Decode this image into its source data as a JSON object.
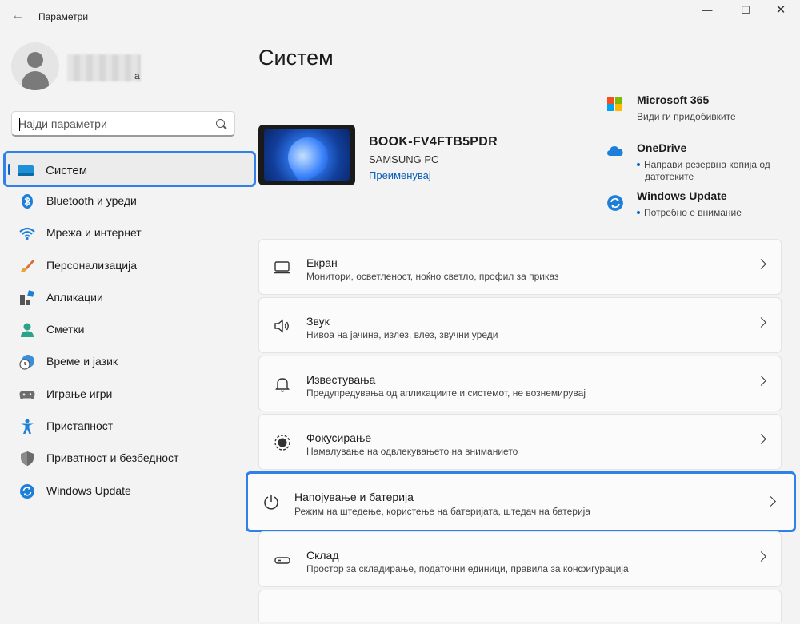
{
  "window": {
    "title": "Параметри",
    "back_label": "←",
    "minimize": "—",
    "maximize": "☐",
    "close": "✕"
  },
  "user": {
    "name_tail": "а"
  },
  "search": {
    "placeholder": "Најди параметри"
  },
  "sidebar": {
    "items": [
      {
        "label": "Систем",
        "icon": "system-icon",
        "active": true
      },
      {
        "label": "Bluetooth и уреди",
        "icon": "bluetooth-icon"
      },
      {
        "label": "Мрежа и интернет",
        "icon": "wifi-icon"
      },
      {
        "label": "Персонализација",
        "icon": "brush-icon"
      },
      {
        "label": "Апликации",
        "icon": "apps-icon"
      },
      {
        "label": "Сметки",
        "icon": "account-icon"
      },
      {
        "label": "Време и јазик",
        "icon": "clock-globe-icon"
      },
      {
        "label": "Играње игри",
        "icon": "gamepad-icon"
      },
      {
        "label": "Пристапност",
        "icon": "accessibility-icon"
      },
      {
        "label": "Приватност и безбедност",
        "icon": "shield-icon"
      },
      {
        "label": "Windows Update",
        "icon": "windows-update-icon"
      }
    ]
  },
  "main": {
    "title": "Систем",
    "device": {
      "name": "BOOK-FV4FTB5PDR",
      "model": "SAMSUNG PC",
      "rename": "Преименувај"
    },
    "quick_links": [
      {
        "title": "Microsoft 365",
        "sub": "Види ги придобивките",
        "icon": "microsoft-365-icon",
        "dot": false
      },
      {
        "title": "OneDrive",
        "sub": "Направи резервна копија од датотеките",
        "icon": "onedrive-icon",
        "dot": true
      },
      {
        "title": "Windows Update",
        "sub": "Потребно е внимание",
        "icon": "windows-update-icon",
        "dot": true
      }
    ],
    "cards": [
      {
        "title": "Екран",
        "sub": "Монитори, осветленост, ноќно светло, профил за приказ",
        "icon": "display-icon"
      },
      {
        "title": "Звук",
        "sub": "Нивоа на јачина, излез, влез, звучни уреди",
        "icon": "speaker-icon"
      },
      {
        "title": "Известувања",
        "sub": "Предупредувања од апликациите и системот, не вознемирувај",
        "icon": "bell-icon"
      },
      {
        "title": "Фокусирање",
        "sub": "Намалување на одвлекувањето на вниманието",
        "icon": "focus-icon"
      },
      {
        "title": "Напојување и батерија",
        "sub": "Режим на штедење, користење на батеријата, штедач на батерија",
        "icon": "power-icon",
        "highlight": true
      },
      {
        "title": "Склад",
        "sub": "Простор за складирање, податочни единици, правила за конфигурација",
        "icon": "storage-icon"
      }
    ]
  },
  "colors": {
    "accent": "#0a64c8",
    "highlight_border": "#2f80e8",
    "background": "#f3f3f3",
    "card": "#fbfbfb"
  }
}
